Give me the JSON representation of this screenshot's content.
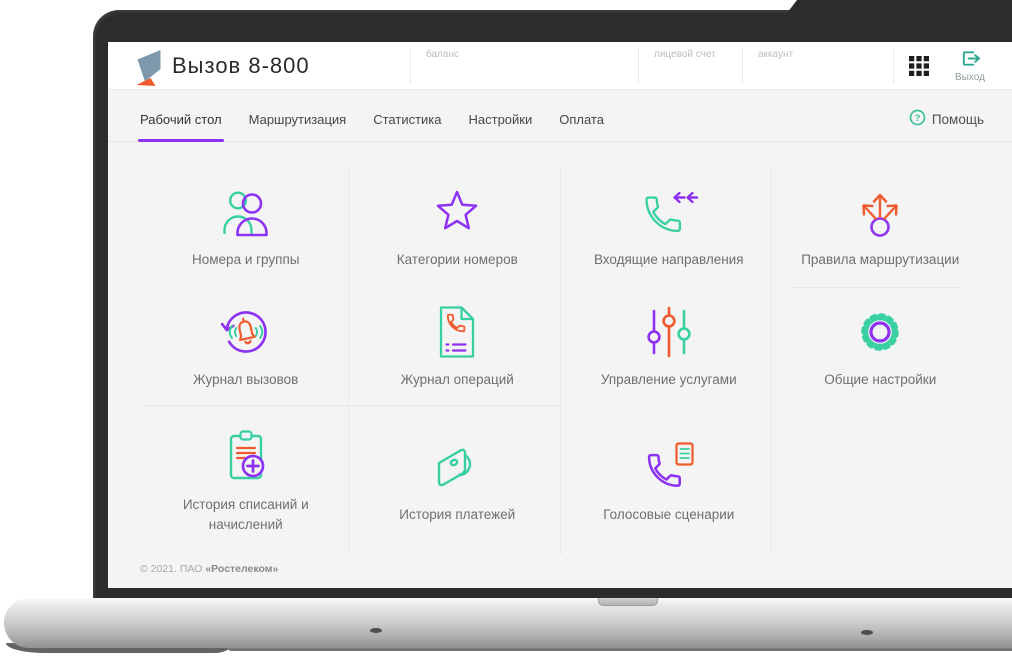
{
  "header": {
    "title": "Вызов 8-800",
    "fields": [
      {
        "label": "баланс"
      },
      {
        "label": "лицевой счет"
      },
      {
        "label": "аккаунт"
      }
    ],
    "logout_label": "Выход"
  },
  "nav": {
    "tabs": [
      {
        "label": "Рабочий стол",
        "active": true
      },
      {
        "label": "Маршрутизация",
        "active": false
      },
      {
        "label": "Статистика",
        "active": false
      },
      {
        "label": "Настройки",
        "active": false
      },
      {
        "label": "Оплата",
        "active": false
      }
    ],
    "help_label": "Помощь"
  },
  "tiles": [
    {
      "label": "Номера и группы",
      "icon": "users-icon"
    },
    {
      "label": "Категории номеров",
      "icon": "star-icon"
    },
    {
      "label": "Входящие направления",
      "icon": "incoming-call-icon"
    },
    {
      "label": "Правила маршрутизации",
      "icon": "routing-arrows-icon"
    },
    {
      "label": "Журнал вызовов",
      "icon": "call-log-icon"
    },
    {
      "label": "Журнал операций",
      "icon": "operations-log-icon"
    },
    {
      "label": "Управление услугами",
      "icon": "sliders-icon"
    },
    {
      "label": "Общие настройки",
      "icon": "gear-icon"
    },
    {
      "label": "История списаний и начислений",
      "icon": "clipboard-plus-icon"
    },
    {
      "label": "История платежей",
      "icon": "wallet-icon"
    },
    {
      "label": "Голосовые сценарии",
      "icon": "voice-script-icon"
    }
  ],
  "footer": {
    "copyright_prefix": "© 2021. ПАО",
    "copyright_company": "«Ростелеком»"
  },
  "colors": {
    "teal": "#38cfa2",
    "purple": "#8d32f2",
    "orange": "#ef5b2e",
    "active_tab_underline": "#8d32f2"
  }
}
